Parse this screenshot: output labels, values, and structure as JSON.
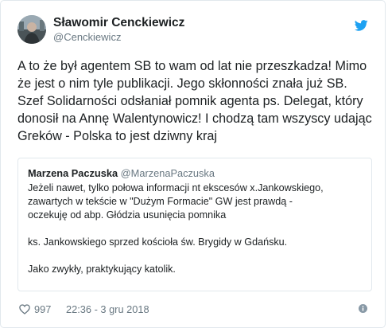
{
  "author": {
    "name": "Sławomir Cenckiewicz",
    "handle": "@Cenckiewicz"
  },
  "tweet": {
    "lines": [
      "A to że był agentem SB to wam od lat nie przeszkadza! Mimo",
      "że jest o nim tyle publikacji. Jego skłonności znała już SB.",
      "Szef Solidarności odsłaniał pomnik agenta ps. Delegat, który",
      "donosił na Annę Walentynowicz! I chodzą tam wszyscy udając",
      "Greków -  Polska to jest dziwny kraj"
    ]
  },
  "quoted": {
    "name": "Marzena Paczuska",
    "handle": "@MarzenaPaczuska",
    "lines": [
      "Jeżeli nawet, tylko połowa informacji nt ekscesów x.Jankowskiego,",
      "zawartych w tekście w \"Dużym Formacie\" GW  jest prawdą -",
      "oczekuję od abp. Głódzia usunięcia pomnika",
      "",
      "ks. Jankowskiego sprzed kościoła św. Brygidy w Gdańsku.",
      "",
      "Jako zwykły, praktykujący katolik."
    ]
  },
  "footer": {
    "likes": "997",
    "timestamp": "22:36 - 3 gru 2018"
  },
  "icons": {
    "brand": "twitter-bird-icon",
    "like": "heart-icon",
    "info": "info-icon"
  },
  "colors": {
    "brand_blue": "#1da1f2",
    "text": "#1c2022",
    "muted": "#697882",
    "border": "#e1e8ed"
  }
}
